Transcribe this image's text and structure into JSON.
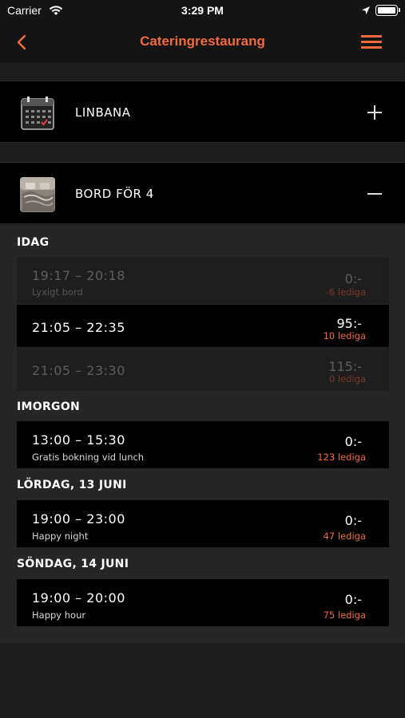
{
  "status_bar": {
    "carrier": "Carrier",
    "time": "3:29 PM",
    "icons": [
      "wifi-icon",
      "location-arrow-icon",
      "battery-icon"
    ]
  },
  "nav": {
    "title": "Cateringrestaurang",
    "back_icon": "chevron-left-icon",
    "menu_icon": "hamburger-menu-icon",
    "accent_color": "#f26a3d"
  },
  "sections": [
    {
      "label": "LINBANA",
      "thumb": "calendar-icon",
      "toggle": "plus-icon",
      "expanded": false
    },
    {
      "label": "BORD FÖR 4",
      "thumb": "table-photo",
      "toggle": "minus-icon",
      "expanded": true
    }
  ],
  "days": [
    {
      "header": "IDAG",
      "slots": [
        {
          "time": "19:17 – 20:18",
          "desc": "Lyxigt bord",
          "price": "0:-",
          "available": "-6 lediga",
          "disabled": true
        },
        {
          "time": "21:05 – 22:35",
          "desc": "",
          "price": "95:-",
          "available": "10 lediga",
          "disabled": false
        },
        {
          "time": "21:05 – 23:30",
          "desc": "",
          "price": "115:-",
          "available": "0 lediga",
          "disabled": true
        }
      ]
    },
    {
      "header": "IMORGON",
      "slots": [
        {
          "time": "13:00 – 15:30",
          "desc": "Gratis bokning vid lunch",
          "price": "0:-",
          "available": "123 lediga",
          "disabled": false
        }
      ]
    },
    {
      "header": "LÖRDAG, 13 JUNI",
      "slots": [
        {
          "time": "19:00 – 23:00",
          "desc": "Happy night",
          "price": "0:-",
          "available": "47 lediga",
          "disabled": false
        }
      ]
    },
    {
      "header": "SÖNDAG, 14 JUNI",
      "slots": [
        {
          "time": "19:00 – 20:00",
          "desc": "Happy hour",
          "price": "0:-",
          "available": "75 lediga",
          "disabled": false
        }
      ]
    }
  ]
}
